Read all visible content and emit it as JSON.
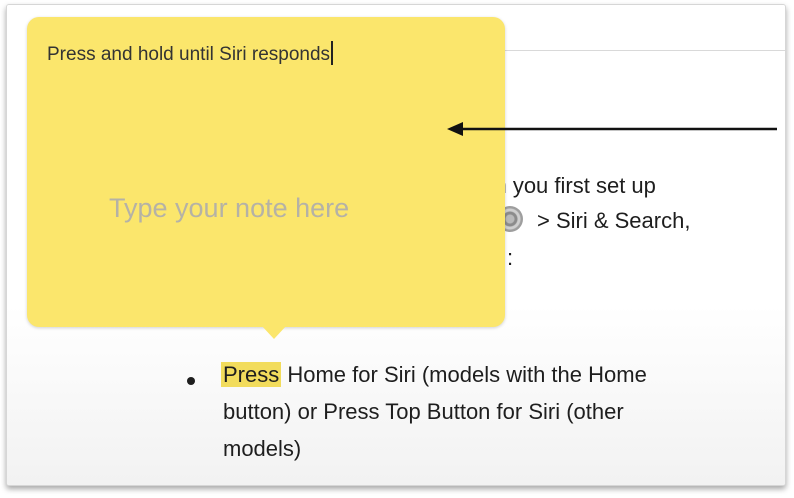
{
  "note": {
    "title": "Press and hold until Siri responds",
    "placeholder": "Type your note here"
  },
  "paragraph": {
    "line1": "hen you first set up",
    "line2": " > Siri & Search,",
    "line3": ":"
  },
  "bullet": {
    "highlight": "Press",
    "line1_rest": " Home for Siri (models with the Home",
    "line2": "button) or Press Top Button for Siri (other",
    "line3": "models)"
  },
  "icons": {
    "settings": "settings-gear-icon",
    "arrow": "annotation-arrow-icon"
  },
  "colors": {
    "note_background": "#fbe66c",
    "highlight": "#f2dc5c",
    "placeholder_text": "#b5b2a6"
  }
}
